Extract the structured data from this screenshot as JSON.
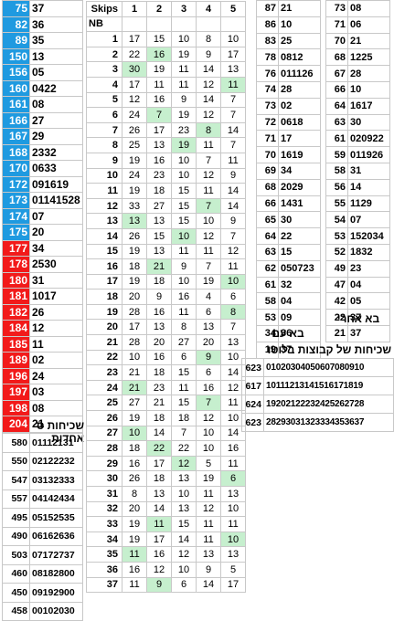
{
  "left_table": [
    {
      "k": "75",
      "v": "37",
      "c": "blue"
    },
    {
      "k": "82",
      "v": "36",
      "c": "blue"
    },
    {
      "k": "89",
      "v": "35",
      "c": "blue"
    },
    {
      "k": "150",
      "v": "13",
      "c": "blue"
    },
    {
      "k": "156",
      "v": "05",
      "c": "blue"
    },
    {
      "k": "160",
      "v": "0422",
      "c": "blue"
    },
    {
      "k": "161",
      "v": "08",
      "c": "blue"
    },
    {
      "k": "166",
      "v": "27",
      "c": "blue"
    },
    {
      "k": "167",
      "v": "29",
      "c": "blue"
    },
    {
      "k": "168",
      "v": "2332",
      "c": "blue"
    },
    {
      "k": "170",
      "v": "0633",
      "c": "blue"
    },
    {
      "k": "172",
      "v": "091619",
      "c": "blue"
    },
    {
      "k": "173",
      "v": "01141528",
      "c": "blue"
    },
    {
      "k": "174",
      "v": "07",
      "c": "blue"
    },
    {
      "k": "175",
      "v": "20",
      "c": "blue"
    },
    {
      "k": "177",
      "v": "34",
      "c": "red"
    },
    {
      "k": "178",
      "v": "2530",
      "c": "red"
    },
    {
      "k": "180",
      "v": "31",
      "c": "red"
    },
    {
      "k": "181",
      "v": "1017",
      "c": "red"
    },
    {
      "k": "182",
      "v": "26",
      "c": "red"
    },
    {
      "k": "184",
      "v": "12",
      "c": "red"
    },
    {
      "k": "185",
      "v": "11",
      "c": "red"
    },
    {
      "k": "189",
      "v": "02",
      "c": "red"
    },
    {
      "k": "196",
      "v": "24",
      "c": "red"
    },
    {
      "k": "197",
      "v": "03",
      "c": "red"
    },
    {
      "k": "198",
      "v": "08",
      "c": "red"
    },
    {
      "k": "204",
      "v": "21",
      "c": "red"
    }
  ],
  "skips": {
    "header": [
      "Skips",
      "1",
      "2",
      "3",
      "4",
      "5"
    ],
    "subheader": "NB",
    "rows": [
      {
        "n": "1",
        "v": [
          "17",
          "15",
          "10",
          "8",
          "10"
        ],
        "g": []
      },
      {
        "n": "2",
        "v": [
          "22",
          "16",
          "19",
          "9",
          "17"
        ],
        "g": [
          1
        ]
      },
      {
        "n": "3",
        "v": [
          "30",
          "19",
          "11",
          "14",
          "13"
        ],
        "g": [
          0
        ]
      },
      {
        "n": "4",
        "v": [
          "17",
          "11",
          "11",
          "12",
          "11"
        ],
        "g": [
          4
        ]
      },
      {
        "n": "5",
        "v": [
          "12",
          "16",
          "9",
          "14",
          "7"
        ],
        "g": []
      },
      {
        "n": "6",
        "v": [
          "24",
          "7",
          "19",
          "12",
          "7"
        ],
        "g": [
          1
        ]
      },
      {
        "n": "7",
        "v": [
          "26",
          "17",
          "23",
          "8",
          "14"
        ],
        "g": [
          3
        ]
      },
      {
        "n": "8",
        "v": [
          "25",
          "13",
          "19",
          "11",
          "7"
        ],
        "g": [
          2
        ]
      },
      {
        "n": "9",
        "v": [
          "19",
          "16",
          "10",
          "7",
          "11"
        ],
        "g": []
      },
      {
        "n": "10",
        "v": [
          "24",
          "23",
          "10",
          "12",
          "9"
        ],
        "g": []
      },
      {
        "n": "11",
        "v": [
          "19",
          "18",
          "15",
          "11",
          "14"
        ],
        "g": []
      },
      {
        "n": "12",
        "v": [
          "33",
          "27",
          "15",
          "7",
          "14"
        ],
        "g": [
          3
        ]
      },
      {
        "n": "13",
        "v": [
          "13",
          "13",
          "15",
          "10",
          "9"
        ],
        "g": [
          0
        ]
      },
      {
        "n": "14",
        "v": [
          "26",
          "15",
          "10",
          "12",
          "7"
        ],
        "g": [
          2
        ]
      },
      {
        "n": "15",
        "v": [
          "19",
          "13",
          "11",
          "11",
          "12"
        ],
        "g": []
      },
      {
        "n": "16",
        "v": [
          "18",
          "21",
          "9",
          "7",
          "11"
        ],
        "g": [
          1
        ]
      },
      {
        "n": "17",
        "v": [
          "19",
          "18",
          "10",
          "19",
          "10"
        ],
        "g": [
          4
        ]
      },
      {
        "n": "18",
        "v": [
          "20",
          "9",
          "16",
          "4",
          "6"
        ],
        "g": []
      },
      {
        "n": "19",
        "v": [
          "28",
          "16",
          "11",
          "6",
          "8"
        ],
        "g": [
          4
        ]
      },
      {
        "n": "20",
        "v": [
          "17",
          "13",
          "8",
          "13",
          "7"
        ],
        "g": []
      },
      {
        "n": "21",
        "v": [
          "28",
          "20",
          "27",
          "20",
          "13"
        ],
        "g": []
      },
      {
        "n": "22",
        "v": [
          "10",
          "16",
          "6",
          "9",
          "10"
        ],
        "g": [
          3
        ]
      },
      {
        "n": "23",
        "v": [
          "21",
          "18",
          "15",
          "6",
          "14"
        ],
        "g": []
      },
      {
        "n": "24",
        "v": [
          "21",
          "23",
          "11",
          "16",
          "12"
        ],
        "g": [
          0
        ]
      },
      {
        "n": "25",
        "v": [
          "27",
          "21",
          "15",
          "7",
          "11"
        ],
        "g": [
          3
        ]
      },
      {
        "n": "26",
        "v": [
          "19",
          "18",
          "18",
          "12",
          "10"
        ],
        "g": []
      },
      {
        "n": "27",
        "v": [
          "10",
          "14",
          "7",
          "10",
          "14"
        ],
        "g": [
          0
        ]
      },
      {
        "n": "28",
        "v": [
          "18",
          "22",
          "22",
          "10",
          "16"
        ],
        "g": [
          1
        ]
      },
      {
        "n": "29",
        "v": [
          "16",
          "17",
          "12",
          "5",
          "11"
        ],
        "g": [
          2
        ]
      },
      {
        "n": "30",
        "v": [
          "26",
          "18",
          "13",
          "19",
          "6"
        ],
        "g": [
          4
        ]
      },
      {
        "n": "31",
        "v": [
          "8",
          "13",
          "10",
          "11",
          "13"
        ],
        "g": []
      },
      {
        "n": "32",
        "v": [
          "20",
          "14",
          "13",
          "12",
          "10"
        ],
        "g": []
      },
      {
        "n": "33",
        "v": [
          "19",
          "11",
          "15",
          "11",
          "11"
        ],
        "g": [
          1
        ]
      },
      {
        "n": "34",
        "v": [
          "19",
          "17",
          "14",
          "11",
          "10"
        ],
        "g": [
          4
        ]
      },
      {
        "n": "35",
        "v": [
          "11",
          "16",
          "12",
          "13",
          "13"
        ],
        "g": [
          0
        ]
      },
      {
        "n": "36",
        "v": [
          "16",
          "12",
          "10",
          "9",
          "5"
        ],
        "g": []
      },
      {
        "n": "37",
        "v": [
          "11",
          "9",
          "6",
          "14",
          "17"
        ],
        "g": [
          1
        ]
      }
    ]
  },
  "mid_table": [
    {
      "k": "87",
      "v": "21"
    },
    {
      "k": "86",
      "v": "10"
    },
    {
      "k": "83",
      "v": "25"
    },
    {
      "k": "78",
      "v": "0812"
    },
    {
      "k": "76",
      "v": "011126"
    },
    {
      "k": "74",
      "v": "28"
    },
    {
      "k": "73",
      "v": "02"
    },
    {
      "k": "72",
      "v": "0618"
    },
    {
      "k": "71",
      "v": "17"
    },
    {
      "k": "70",
      "v": "1619"
    },
    {
      "k": "69",
      "v": "34"
    },
    {
      "k": "68",
      "v": "2029"
    },
    {
      "k": "66",
      "v": "1431"
    },
    {
      "k": "65",
      "v": "30"
    },
    {
      "k": "64",
      "v": "22"
    },
    {
      "k": "63",
      "v": "15"
    },
    {
      "k": "62",
      "v": "050723"
    },
    {
      "k": "61",
      "v": "32"
    },
    {
      "k": "58",
      "v": "04"
    },
    {
      "k": "53",
      "v": "09"
    },
    {
      "k": "34",
      "v": "36"
    },
    {
      "k": "19",
      "v": "37"
    }
  ],
  "mid_caption": "בא עם",
  "right_table": [
    {
      "k": "73",
      "v": "08"
    },
    {
      "k": "71",
      "v": "06"
    },
    {
      "k": "70",
      "v": "21"
    },
    {
      "k": "68",
      "v": "1225"
    },
    {
      "k": "67",
      "v": "28"
    },
    {
      "k": "66",
      "v": "10"
    },
    {
      "k": "64",
      "v": "1617"
    },
    {
      "k": "63",
      "v": "30"
    },
    {
      "k": "61",
      "v": "020922"
    },
    {
      "k": "59",
      "v": "011926"
    },
    {
      "k": "58",
      "v": "31"
    },
    {
      "k": "56",
      "v": "14"
    },
    {
      "k": "55",
      "v": "1129"
    },
    {
      "k": "54",
      "v": "07"
    },
    {
      "k": "53",
      "v": "152034"
    },
    {
      "k": "52",
      "v": "1832"
    },
    {
      "k": "49",
      "v": "23"
    },
    {
      "k": "47",
      "v": "04"
    },
    {
      "k": "42",
      "v": "05"
    },
    {
      "k": "22",
      "v": "37"
    },
    {
      "k": "21",
      "v": "37"
    }
  ],
  "right_caption": "בא אחרי",
  "groups_caption": "שכיחות של קבוצות בלוטו",
  "groups_table": [
    {
      "k": "623",
      "v": "01020304050607080910"
    },
    {
      "k": "617",
      "v": "10111213141516171819"
    },
    {
      "k": "624",
      "v": "19202122232425262728"
    },
    {
      "k": "623",
      "v": "28293031323334353637"
    }
  ],
  "ones_caption": "שכיחות ס אחדות",
  "ones_table": [
    {
      "k": "580",
      "v": "01112131"
    },
    {
      "k": "550",
      "v": "02122232"
    },
    {
      "k": "547",
      "v": "03132333"
    },
    {
      "k": "557",
      "v": "04142434"
    },
    {
      "k": "495",
      "v": "05152535"
    },
    {
      "k": "490",
      "v": "06162636"
    },
    {
      "k": "503",
      "v": "07172737"
    },
    {
      "k": "460",
      "v": "08182800"
    },
    {
      "k": "450",
      "v": "09192900"
    },
    {
      "k": "458",
      "v": "00102030"
    }
  ],
  "colors": {
    "blue": "#1f9ae0",
    "red": "#f21a1a",
    "highlight": "#c6efce"
  }
}
